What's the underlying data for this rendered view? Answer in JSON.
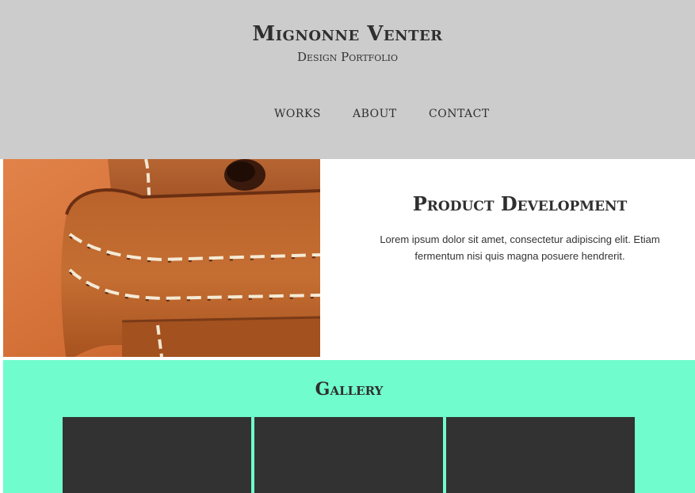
{
  "header": {
    "title": "Mignonne Venter",
    "subtitle": "Design Portfolio",
    "background": "#cccccc"
  },
  "nav": {
    "items": [
      {
        "label": "WORKS"
      },
      {
        "label": "ABOUT"
      },
      {
        "label": "CONTACT"
      }
    ]
  },
  "feature": {
    "image": "leather-strap-stitching-photo",
    "title": "Product Development",
    "text": "Lorem ipsum dolor sit amet, consectetur adipiscing elit. Etiam fermentum nisi quis magna posuere hendrerit."
  },
  "gallery": {
    "title": "Gallery",
    "background": "#70fccc",
    "tile_color": "#323232",
    "tiles": [
      "gallery-item",
      "gallery-item",
      "gallery-item"
    ]
  }
}
